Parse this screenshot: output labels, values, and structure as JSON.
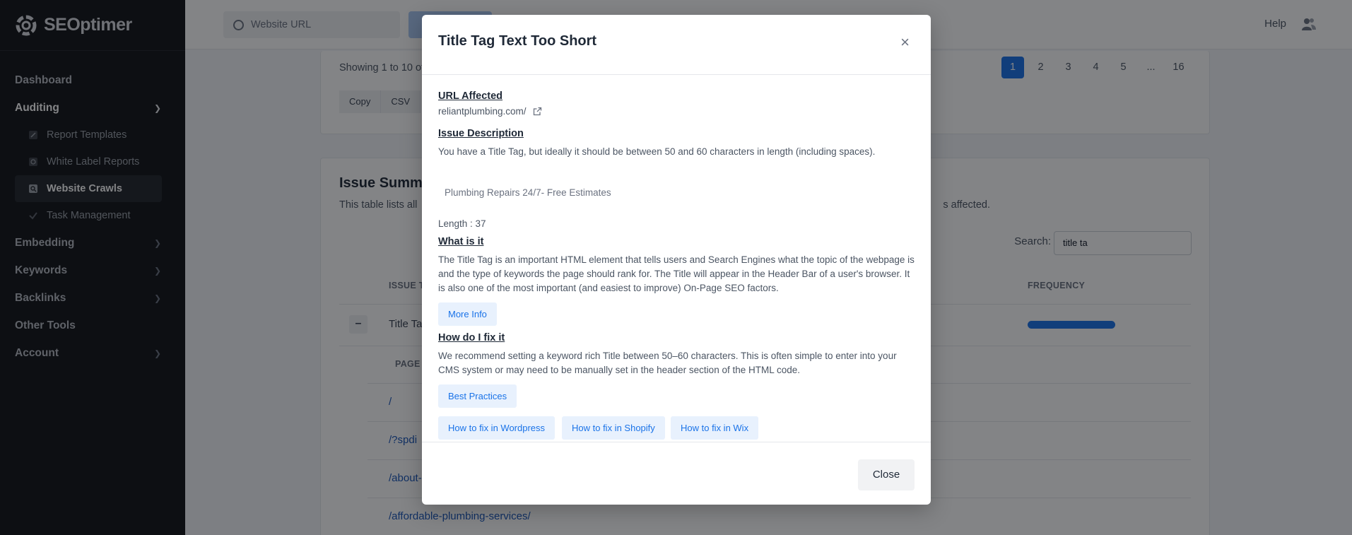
{
  "app": {
    "logo_text": "SEOptimer"
  },
  "sidebar": {
    "items": [
      {
        "label": "Dashboard"
      },
      {
        "label": "Auditing"
      },
      {
        "label": "Embedding"
      },
      {
        "label": "Keywords"
      },
      {
        "label": "Backlinks"
      },
      {
        "label": "Other Tools"
      },
      {
        "label": "Account"
      }
    ],
    "auditing_sub": [
      {
        "label": "Report Templates"
      },
      {
        "label": "White Label Reports"
      },
      {
        "label": "Website Crawls"
      },
      {
        "label": "Task Management"
      }
    ]
  },
  "topbar": {
    "url_placeholder": "Website URL",
    "help_label": "Help"
  },
  "main": {
    "showing_text": "Showing 1 to 10 of",
    "export_buttons": [
      "Copy",
      "CSV"
    ],
    "pagination": [
      "1",
      "2",
      "3",
      "4",
      "5",
      "...",
      "16"
    ],
    "issue_summary_title": "Issue Summa",
    "issue_summary_desc": "This table lists all",
    "issue_summary_desc_tail": "s affected.",
    "search_label": "Search:",
    "search_value": "title ta",
    "col_issue": "ISSUE T",
    "col_frequency": "FREQUENCY",
    "row_name": "Title Ta",
    "toggle_symbol": "–",
    "col_page": "PAGE",
    "pages": [
      "/",
      "/?spdi",
      "/about-",
      "/affordable-plumbing-services/"
    ]
  },
  "modal": {
    "title": "Title Tag Text Too Short",
    "close_x": "×",
    "url_affected_heading": "URL Affected",
    "url": "reliantplumbing.com/",
    "issue_desc_heading": "Issue Description",
    "issue_desc": "You have a Title Tag, but ideally it should be between 50 and 60 characters in length (including spaces).",
    "title_value": "Plumbing Repairs 24/7- Free Estimates",
    "length_text": "Length : 37",
    "what_heading": "What is it",
    "what_text": "The Title Tag is an important HTML element that tells users and Search Engines what the topic of the webpage is and the type of keywords the page should rank for. The Title will appear in the Header Bar of a user's browser. It is also one of the most important (and easiest to improve) On-Page SEO factors.",
    "more_info": "More Info",
    "fix_heading": "How do I fix it",
    "fix_text": "We recommend setting a keyword rich Title between 50–60 characters. This is often simple to enter into your CMS system or may need to be manually set in the header section of the HTML code.",
    "best_practices": "Best Practices",
    "fix_wordpress": "How to fix in Wordpress",
    "fix_shopify": "How to fix in Shopify",
    "fix_wix": "How to fix in Wix",
    "close_label": "Close"
  }
}
